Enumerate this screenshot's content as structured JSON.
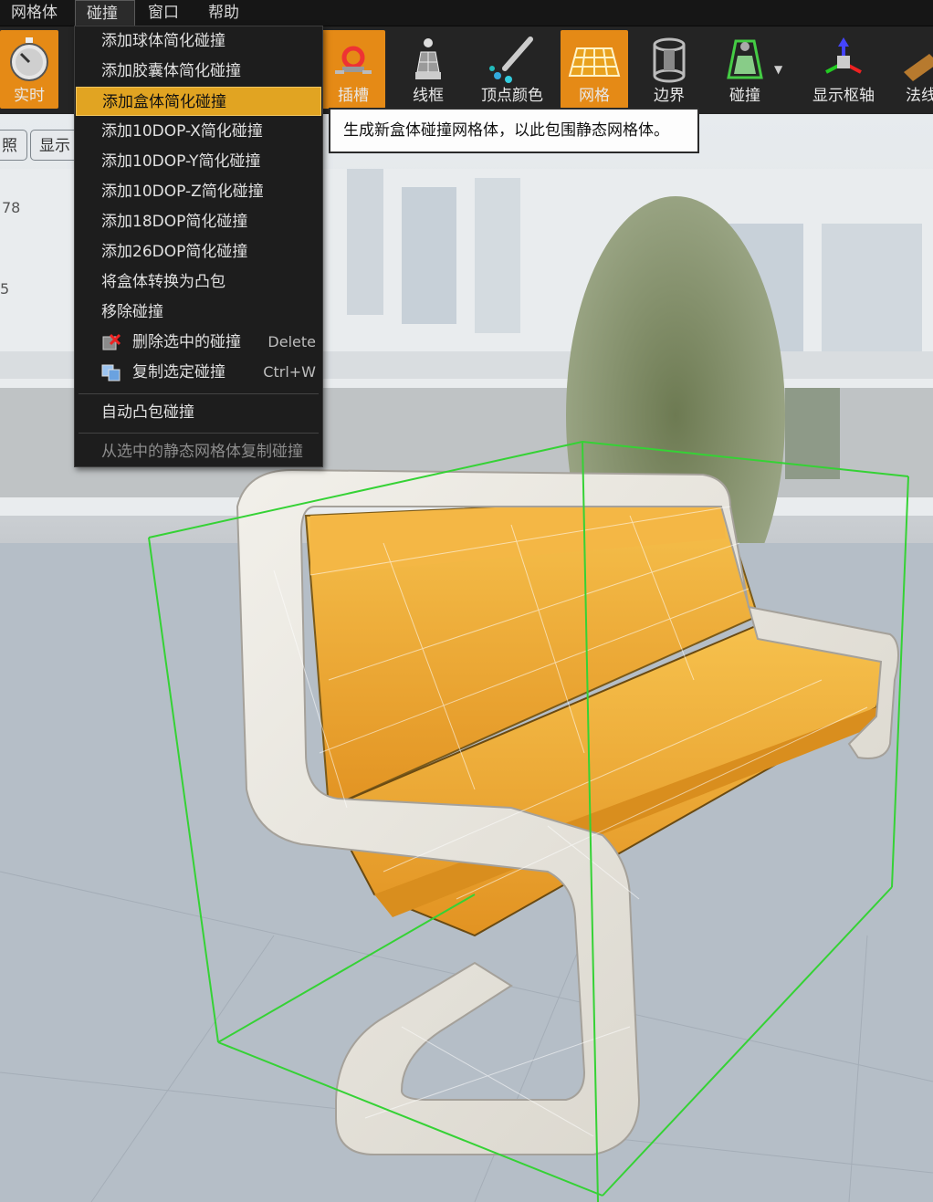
{
  "menubar": {
    "items": [
      "网格体",
      "碰撞",
      "窗口",
      "帮助"
    ],
    "active": "碰撞"
  },
  "toolbar": {
    "items": [
      {
        "label": "实时",
        "icon": "stopwatch-icon",
        "active": true
      },
      {
        "label": "插槽",
        "icon": "socket-icon",
        "active": true
      },
      {
        "label": "线框",
        "icon": "wireframe-icon",
        "active": false
      },
      {
        "label": "顶点颜色",
        "icon": "vertex-color-icon",
        "active": false
      },
      {
        "label": "网格",
        "icon": "grid-icon",
        "active": true
      },
      {
        "label": "边界",
        "icon": "bounds-icon",
        "active": false
      },
      {
        "label": "碰撞",
        "icon": "collision-icon",
        "active": false
      },
      {
        "label": "显示枢轴",
        "icon": "pivot-icon",
        "active": false
      },
      {
        "label": "法线",
        "icon": "normals-icon",
        "active": false
      }
    ],
    "clipped_labels": {
      "socket": "插槽",
      "normals": "法线"
    }
  },
  "viewport": {
    "buttons": [
      "照",
      "显示"
    ],
    "stats": [
      "78",
      "5"
    ]
  },
  "collision_menu": {
    "items": [
      {
        "label": "添加球体简化碰撞"
      },
      {
        "label": "添加胶囊体简化碰撞"
      },
      {
        "label": "添加盒体简化碰撞",
        "highlighted": true
      },
      {
        "label": "添加10DOP-X简化碰撞"
      },
      {
        "label": "添加10DOP-Y简化碰撞"
      },
      {
        "label": "添加10DOP-Z简化碰撞"
      },
      {
        "label": "添加18DOP简化碰撞"
      },
      {
        "label": "添加26DOP简化碰撞"
      },
      {
        "label": "将盒体转换为凸包"
      },
      {
        "label": "移除碰撞"
      },
      {
        "label": "删除选中的碰撞",
        "shortcut": "Delete",
        "icon": "delete-collision-icon"
      },
      {
        "label": "复制选定碰撞",
        "shortcut": "Ctrl+W",
        "icon": "duplicate-collision-icon"
      },
      {
        "label": "自动凸包碰撞"
      },
      {
        "label": "从选中的静态网格体复制碰撞",
        "disabled": true
      }
    ]
  },
  "tooltip": "生成新盒体碰撞网格体，以此包围静态网格体。",
  "colors": {
    "accent": "#e58a16",
    "highlight": "#e1a422",
    "collision_box": "#35d235",
    "cushion": "#f0a838"
  }
}
